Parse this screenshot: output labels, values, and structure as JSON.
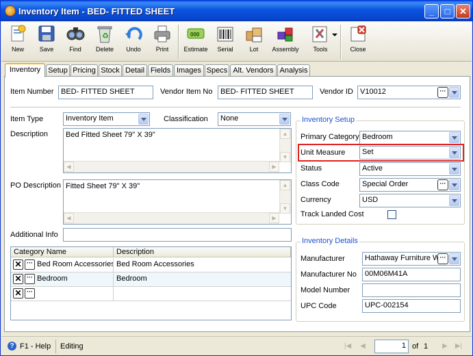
{
  "window": {
    "title": "Inventory Item - BED- FITTED SHEET"
  },
  "toolbar": {
    "new": "New",
    "save": "Save",
    "find": "Find",
    "delete": "Delete",
    "undo": "Undo",
    "print": "Print",
    "estimate": "Estimate",
    "serial": "Serial",
    "lot": "Lot",
    "assembly": "Assembly",
    "tools": "Tools",
    "close": "Close"
  },
  "tabs": [
    "Inventory",
    "Setup",
    "Pricing",
    "Stock",
    "Detail",
    "Fields",
    "Images",
    "Specs",
    "Alt. Vendors",
    "Analysis"
  ],
  "form": {
    "item_number_label": "Item Number",
    "item_number": "BED- FITTED SHEET",
    "vendor_item_no_label": "Vendor Item No",
    "vendor_item_no": "BED- FITTED SHEET",
    "vendor_id_label": "Vendor ID",
    "vendor_id": "V10012",
    "item_type_label": "Item Type",
    "item_type": "Inventory Item",
    "classification_label": "Classification",
    "classification": "None",
    "description_label": "Description",
    "description": "Bed Fitted Sheet 79\" X 39\"",
    "po_description_label": "PO Description",
    "po_description": "Fitted Sheet 79\" X 39\"",
    "additional_info_label": "Additional Info",
    "additional_info": ""
  },
  "grid": {
    "headers": [
      "Category Name",
      "Description"
    ],
    "rows": [
      {
        "category": "Bed Room Accessories",
        "description": "Bed Room Accessories"
      },
      {
        "category": "Bedroom",
        "description": "Bedroom"
      },
      {
        "category": "",
        "description": ""
      }
    ]
  },
  "setup": {
    "title": "Inventory Setup",
    "primary_category_label": "Primary Category",
    "primary_category": "Bedroom",
    "unit_measure_label": "Unit Measure",
    "unit_measure": "Set",
    "status_label": "Status",
    "status": "Active",
    "class_code_label": "Class Code",
    "class_code": "Special Order",
    "currency_label": "Currency",
    "currency": "USD",
    "track_landed_cost_label": "Track Landed Cost",
    "track_landed_cost": false
  },
  "details": {
    "title": "Inventory Details",
    "manufacturer_label": "Manufacturer",
    "manufacturer": "Hathaway Furniture W",
    "manufacturer_no_label": "Manufacturer No",
    "manufacturer_no": "00M06M41A",
    "model_number_label": "Model Number",
    "model_number": "",
    "upc_code_label": "UPC Code",
    "upc_code": "UPC-002154"
  },
  "status": {
    "help": "F1 - Help",
    "mode": "Editing",
    "page": "1",
    "of": "of",
    "total": "1"
  },
  "colors": {
    "highlight_border": "#e02020",
    "group_title": "#1b4fd0",
    "titlebar": "#0a54e0"
  }
}
